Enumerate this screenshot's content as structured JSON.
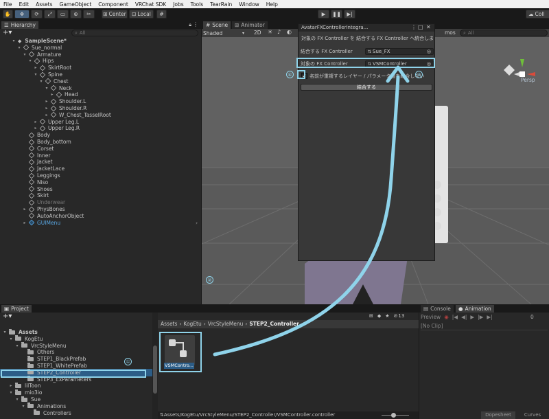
{
  "menubar": [
    "File",
    "Edit",
    "Assets",
    "GameObject",
    "Component",
    "VRChat SDK",
    "Jobs",
    "Tools",
    "TearRain",
    "Window",
    "Help"
  ],
  "toolbar": {
    "pivot_center": "Center",
    "pivot_local": "Local",
    "collab": "Coll"
  },
  "hierarchy": {
    "tab": "Hierarchy",
    "search_placeholder": "All",
    "items": [
      {
        "label": "SampleScene*",
        "depth": 0,
        "arrow": "▾",
        "icon": "scene"
      },
      {
        "label": "Sue_normal",
        "depth": 1,
        "arrow": "▾",
        "icon": "cube"
      },
      {
        "label": "Armature",
        "depth": 2,
        "arrow": "▾",
        "icon": "cube"
      },
      {
        "label": "Hips",
        "depth": 3,
        "arrow": "▾",
        "icon": "cube"
      },
      {
        "label": "SkirtRoot",
        "depth": 4,
        "arrow": "▸",
        "icon": "cube"
      },
      {
        "label": "Spine",
        "depth": 4,
        "arrow": "▾",
        "icon": "cube"
      },
      {
        "label": "Chest",
        "depth": 5,
        "arrow": "▾",
        "icon": "cube"
      },
      {
        "label": "Neck",
        "depth": 6,
        "arrow": "▾",
        "icon": "cube"
      },
      {
        "label": "Head",
        "depth": 7,
        "arrow": "▸",
        "icon": "cube"
      },
      {
        "label": "Shoulder.L",
        "depth": 6,
        "arrow": "▸",
        "icon": "cube"
      },
      {
        "label": "Shoulder.R",
        "depth": 6,
        "arrow": "▸",
        "icon": "cube"
      },
      {
        "label": "W_Chest_TasselRoot",
        "depth": 6,
        "arrow": "▸",
        "icon": "cube"
      },
      {
        "label": "Upper Leg.L",
        "depth": 4,
        "arrow": "▸",
        "icon": "cube"
      },
      {
        "label": "Upper Leg.R",
        "depth": 4,
        "arrow": "▸",
        "icon": "cube"
      },
      {
        "label": "Body",
        "depth": 2,
        "arrow": "",
        "icon": "cube"
      },
      {
        "label": "Body_bottom",
        "depth": 2,
        "arrow": "",
        "icon": "cube"
      },
      {
        "label": "Corset",
        "depth": 2,
        "arrow": "",
        "icon": "cube"
      },
      {
        "label": "Inner",
        "depth": 2,
        "arrow": "",
        "icon": "cube"
      },
      {
        "label": "Jacket",
        "depth": 2,
        "arrow": "",
        "icon": "cube"
      },
      {
        "label": "JacketLace",
        "depth": 2,
        "arrow": "",
        "icon": "cube"
      },
      {
        "label": "Leggings",
        "depth": 2,
        "arrow": "",
        "icon": "cube"
      },
      {
        "label": "Niso",
        "depth": 2,
        "arrow": "",
        "icon": "cube"
      },
      {
        "label": "Shoes",
        "depth": 2,
        "arrow": "",
        "icon": "cube"
      },
      {
        "label": "Skirt",
        "depth": 2,
        "arrow": "",
        "icon": "cube"
      },
      {
        "label": "Underwear",
        "depth": 2,
        "arrow": "",
        "icon": "cube",
        "disabled": true
      },
      {
        "label": "PhysBones",
        "depth": 2,
        "arrow": "▸",
        "icon": "cube"
      },
      {
        "label": "AutoAnchorObject",
        "depth": 2,
        "arrow": "",
        "icon": "cube"
      },
      {
        "label": "GUIMenu",
        "depth": 2,
        "arrow": "▸",
        "icon": "cube-blue",
        "blue": true
      }
    ]
  },
  "scene": {
    "tabs": [
      "Scene",
      "Animator"
    ],
    "shading": "Shaded",
    "mode_2d": "2D",
    "gizmos": "mos",
    "search_placeholder": "All",
    "persp": "Persp"
  },
  "fx_window": {
    "title": "AvatarFXControllerIntegra...",
    "description": "対象の FX Controller を 結合する FX Controller へ統合しま",
    "field1_label": "結合する FX Controller",
    "field1_value": "Sue_FX",
    "field2_label": "対象の FX Controller",
    "field2_value": "VSMController",
    "checkbox_label": "名前が重複するレイヤー / パラメータ値を結合しない",
    "checkbox_checked": true,
    "merge_button": "結合する"
  },
  "project": {
    "tab": "Project",
    "breadcrumb": [
      "Assets",
      "KogEtu",
      "VrcStyleMenu",
      "STEP2_Controller"
    ],
    "badge_count": "13",
    "tree": [
      {
        "label": "Assets",
        "depth": 0,
        "arrow": "▾",
        "bold": true
      },
      {
        "label": "KogEtu",
        "depth": 1,
        "arrow": "▾"
      },
      {
        "label": "VrcStyleMenu",
        "depth": 2,
        "arrow": "▾"
      },
      {
        "label": "Others",
        "depth": 3,
        "arrow": ""
      },
      {
        "label": "STEP1_BlackPrefab",
        "depth": 3,
        "arrow": ""
      },
      {
        "label": "STEP1_WhitePrefab",
        "depth": 3,
        "arrow": ""
      },
      {
        "label": "STEP2_Controller",
        "depth": 3,
        "arrow": "",
        "selected": true
      },
      {
        "label": "STEP3_ExParameters",
        "depth": 3,
        "arrow": ""
      },
      {
        "label": "lilToon",
        "depth": 1,
        "arrow": "▸"
      },
      {
        "label": "mio3io",
        "depth": 1,
        "arrow": "▾"
      },
      {
        "label": "Sue",
        "depth": 2,
        "arrow": "▾"
      },
      {
        "label": "Animations",
        "depth": 3,
        "arrow": "▾"
      },
      {
        "label": "Controllers",
        "depth": 4,
        "arrow": ""
      }
    ],
    "asset_name": "VSMContro...",
    "status_path": "Assets/KogEtu/VrcStyleMenu/STEP2_Controller/VSMController.controller"
  },
  "animation": {
    "tabs": [
      "Console",
      "Animation"
    ],
    "preview": "Preview",
    "clip": "[No Clip]",
    "frame": "0",
    "bottom_tabs": [
      "Dopesheet",
      "Curves"
    ]
  },
  "annotations": [
    "①",
    "②",
    "③",
    "④"
  ],
  "colors": {
    "annotation": "#8fd3ea",
    "selection": "#2c5d87",
    "accent_blue": "#5aa9e6"
  }
}
